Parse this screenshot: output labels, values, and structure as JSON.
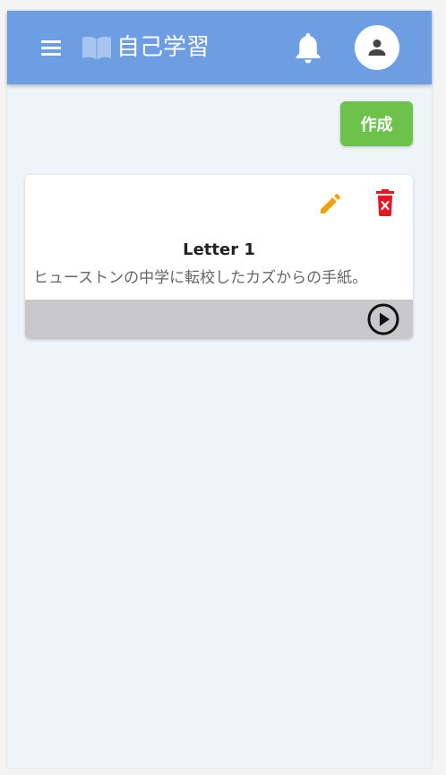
{
  "colors": {
    "app_bar": "#6d9de3",
    "background": "#eef4fa",
    "create_button": "#6dc24b",
    "edit_icon": "#f0a000",
    "delete_icon": "#e8141e",
    "card_footer": "#c8c8cb"
  },
  "app_bar": {
    "title": "自己学習",
    "icons": [
      "menu-icon",
      "book-icon",
      "bell-icon",
      "account-icon"
    ]
  },
  "toolbar": {
    "create_label": "作成"
  },
  "cards": [
    {
      "title": "Letter 1",
      "description": "ヒューストンの中学に転校したカズからの手紙。",
      "icons": [
        "edit-icon",
        "delete-icon",
        "play-icon"
      ]
    }
  ]
}
